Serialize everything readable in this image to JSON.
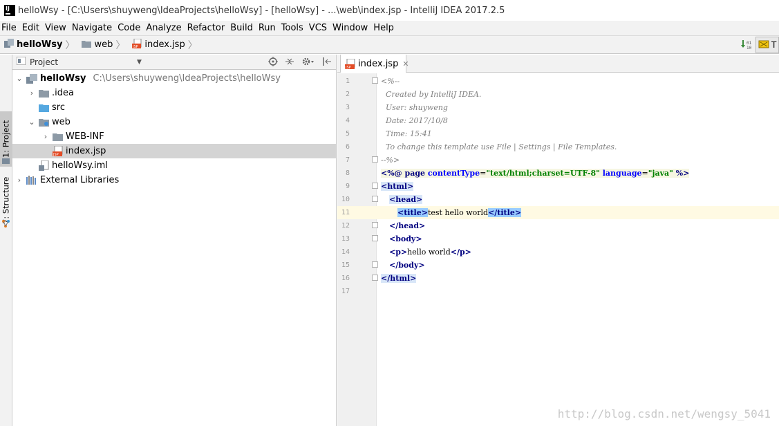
{
  "window": {
    "title": "helloWsy - [C:\\Users\\shuyweng\\IdeaProjects\\helloWsy] - [helloWsy] - ...\\web\\index.jsp - IntelliJ IDEA 2017.2.5"
  },
  "menu": [
    {
      "label": "File"
    },
    {
      "label": "Edit"
    },
    {
      "label": "View"
    },
    {
      "label": "Navigate"
    },
    {
      "label": "Code"
    },
    {
      "label": "Analyze"
    },
    {
      "label": "Refactor"
    },
    {
      "label": "Build"
    },
    {
      "label": "Run"
    },
    {
      "label": "Tools"
    },
    {
      "label": "VCS"
    },
    {
      "label": "Window"
    },
    {
      "label": "Help"
    }
  ],
  "breadcrumbs": [
    {
      "label": "helloWsy",
      "icon": "module-icon"
    },
    {
      "label": "web",
      "icon": "folder-icon"
    },
    {
      "label": "index.jsp",
      "icon": "jsp-file-icon"
    }
  ],
  "toolbar": {
    "right_button_label": "T"
  },
  "side_tabs": {
    "project": "1: Project",
    "structure": "7: Structure"
  },
  "project_panel": {
    "header_label": "Project",
    "tree": [
      {
        "label": "helloWsy",
        "path": "C:\\Users\\shuyweng\\IdeaProjects\\helloWsy",
        "level": 0,
        "expanded": true,
        "icon": "module-icon",
        "bold": true
      },
      {
        "label": ".idea",
        "level": 1,
        "expanded": false,
        "icon": "folder-icon"
      },
      {
        "label": "src",
        "level": 1,
        "icon": "source-folder-icon"
      },
      {
        "label": "web",
        "level": 1,
        "expanded": true,
        "icon": "web-folder-icon"
      },
      {
        "label": "WEB-INF",
        "level": 2,
        "expanded": false,
        "icon": "folder-icon"
      },
      {
        "label": "index.jsp",
        "level": 2,
        "icon": "jsp-file-icon",
        "selected": true
      },
      {
        "label": "helloWsy.iml",
        "level": 1,
        "icon": "iml-file-icon"
      },
      {
        "label": "External Libraries",
        "level": 0,
        "expanded": false,
        "icon": "libraries-icon"
      }
    ]
  },
  "editor": {
    "tab_label": "index.jsp",
    "current_line": 11,
    "lines": [
      {
        "n": "1"
      },
      {
        "n": "2"
      },
      {
        "n": "3"
      },
      {
        "n": "4"
      },
      {
        "n": "5"
      },
      {
        "n": "6"
      },
      {
        "n": "7"
      },
      {
        "n": "8"
      },
      {
        "n": "9"
      },
      {
        "n": "10"
      },
      {
        "n": "11"
      },
      {
        "n": "12"
      },
      {
        "n": "13"
      },
      {
        "n": "14"
      },
      {
        "n": "15"
      },
      {
        "n": "16"
      },
      {
        "n": "17"
      }
    ],
    "code": {
      "l1": "<%--",
      "l2": "  Created by IntelliJ IDEA.",
      "l3": "  User: shuyweng",
      "l4": "  Date: 2017/10/8",
      "l5": "  Time: 15:41",
      "l6": "  To change this template use File | Settings | File Templates.",
      "l7": "--%>",
      "l8_open": "<%@ ",
      "l8_page": "page ",
      "l8_attr1": "contentType",
      "l8_eq1": "=",
      "l8_val1": "\"text/html;charset=UTF-8\"",
      "l8_attr2": " language",
      "l8_eq2": "=",
      "l8_val2": "\"java\"",
      "l8_close": " %>",
      "l9": "<html>",
      "l10": "<head>",
      "l11_open": "<title>",
      "l11_text": "test hello world",
      "l11_close": "</title>",
      "l12": "</head>",
      "l13": "<body>",
      "l14_open": "<p>",
      "l14_text": "hello world",
      "l14_close": "</p>",
      "l15": "</body>",
      "l16": "</html>"
    }
  },
  "watermark": "http://blog.csdn.net/wengsy_5041"
}
